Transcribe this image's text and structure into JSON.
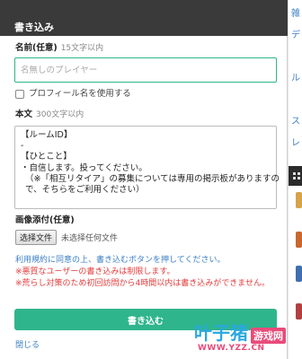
{
  "modal": {
    "title": "書き込み",
    "name_label": "名前(任意)",
    "name_hint": "15文字以内",
    "name_placeholder": "名無しのプレイヤー",
    "profile_checkbox_label": "プロフィール名を使用する",
    "body_label": "本文",
    "body_hint": "300文字以内",
    "body_lines": [
      "【ルームID】",
      "-",
      "【ひとこと】",
      "・自信します。投ってください。",
      "（※「相互リタイア」の募集については専用の掲示板がありますの",
      "で、そちらをご利用ください）"
    ],
    "image_label": "画像添付(任意)",
    "file_button": "选择文件",
    "file_status": "未选择任何文件",
    "notices": [
      {
        "kind": "info",
        "text": "利用規約に同意の上、書き込むボタンを押してください。"
      },
      {
        "kind": "warn",
        "text": "※悪質なユーザーの書き込みは制限します。"
      },
      {
        "kind": "warn",
        "text": "※荒らし対策のため初回訪問から4時間以内は書き込みができません。"
      }
    ],
    "submit_label": "書き込む",
    "close_label": "閉じる"
  },
  "sidebar": {
    "text_fragments": [
      "雑",
      "デ",
      "ル",
      "ス",
      "レ"
    ]
  },
  "watermark": {
    "chars": "叶子猪",
    "sub": "游戏网",
    "url": "WWW.YZZ.CN"
  },
  "colors": {
    "accent": "#2fb58b",
    "header": "#3a3a3a",
    "link": "#3b7fc4",
    "warning": "#e53b3b"
  }
}
